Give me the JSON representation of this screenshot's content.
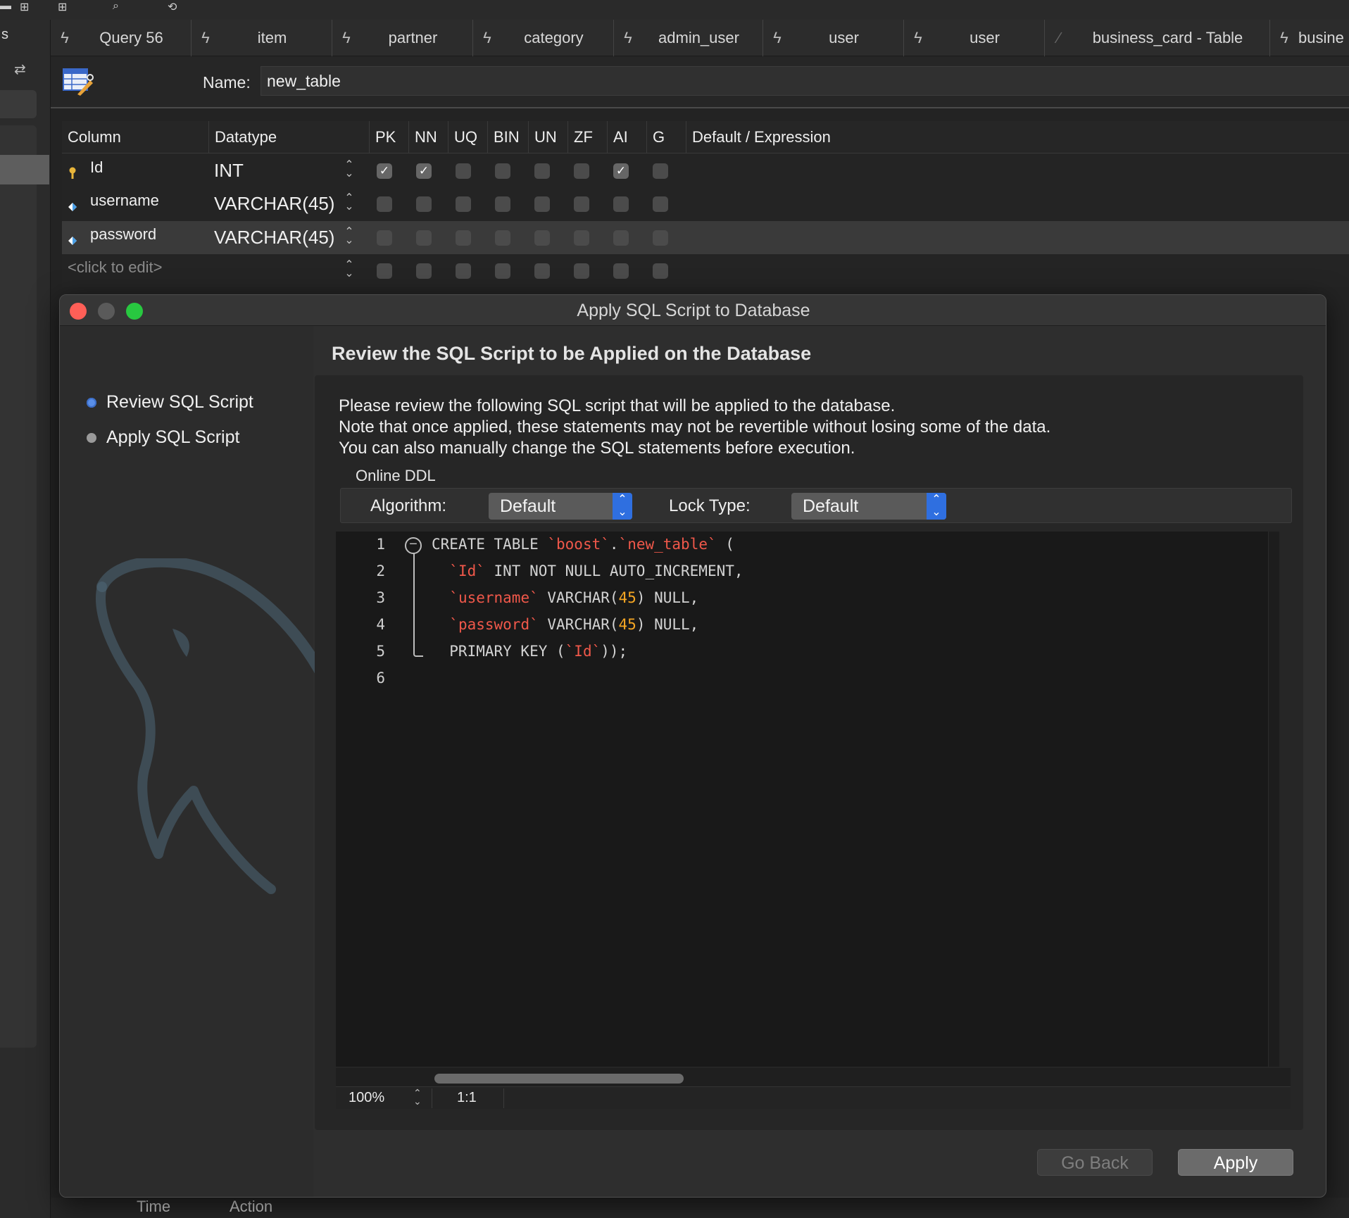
{
  "tabs": [
    {
      "label": "Query 56",
      "icon": "bolt-icon"
    },
    {
      "label": "item",
      "icon": "bolt-icon"
    },
    {
      "label": "partner",
      "icon": "bolt-icon"
    },
    {
      "label": "category",
      "icon": "bolt-icon"
    },
    {
      "label": "admin_user",
      "icon": "bolt-icon"
    },
    {
      "label": "user",
      "icon": "bolt-icon"
    },
    {
      "label": "user",
      "icon": "bolt-icon"
    },
    {
      "label": "business_card - Table",
      "icon": "pencil-icon"
    },
    {
      "label": "busine",
      "icon": "bolt-icon"
    }
  ],
  "table_editor": {
    "name_label": "Name:",
    "name_value": "new_table",
    "headers": {
      "column": "Column",
      "datatype": "Datatype",
      "pk": "PK",
      "nn": "NN",
      "uq": "UQ",
      "bin": "BIN",
      "un": "UN",
      "zf": "ZF",
      "ai": "AI",
      "g": "G",
      "default": "Default / Expression"
    },
    "rows": [
      {
        "name": "Id",
        "type": "INT",
        "flags": [
          true,
          true,
          false,
          false,
          false,
          false,
          true,
          false
        ]
      },
      {
        "name": "username",
        "type": "VARCHAR(45)",
        "flags": [
          false,
          false,
          false,
          false,
          false,
          false,
          false,
          false
        ]
      },
      {
        "name": "password",
        "type": "VARCHAR(45)",
        "flags": [
          false,
          false,
          false,
          false,
          false,
          false,
          false,
          false
        ]
      },
      {
        "name": "<click to edit>",
        "type": "",
        "flags": [
          false,
          false,
          false,
          false,
          false,
          false,
          false,
          false
        ]
      }
    ]
  },
  "dialog": {
    "title": "Apply SQL Script to Database",
    "heading": "Review the SQL Script to be Applied on the Database",
    "steps": [
      {
        "label": "Review SQL Script",
        "active": true
      },
      {
        "label": "Apply SQL Script",
        "active": false
      }
    ],
    "description": [
      "Please review the following SQL script that will be applied to the database.",
      "Note that once applied, these statements may not be revertible without losing some of the data.",
      "You can also manually change the SQL statements before execution."
    ],
    "online_ddl": {
      "legend": "Online DDL",
      "algorithm_label": "Algorithm:",
      "algorithm_value": "Default",
      "lock_label": "Lock Type:",
      "lock_value": "Default"
    },
    "line_numbers": [
      "1",
      "2",
      "3",
      "4",
      "5",
      "6"
    ],
    "code_lines": [
      "CREATE TABLE `boost`.`new_table` (",
      "  `Id` INT NOT NULL AUTO_INCREMENT,",
      "  `username` VARCHAR(45) NULL,",
      "  `password` VARCHAR(45) NULL,",
      "  PRIMARY KEY (`Id`));",
      ""
    ],
    "zoom": "100%",
    "cursor_pos": "1:1",
    "go_back_label": "Go Back",
    "apply_label": "Apply"
  },
  "bottom_panel": {
    "time_col": "Time",
    "action_col": "Action"
  },
  "colors": {
    "accent_blue": "#2f6fe0",
    "sql_identifier": "#f0584a",
    "sql_number": "#f5a623",
    "close": "#ff5f57",
    "minimize": "#5a5a5a",
    "zoom": "#28c840"
  }
}
